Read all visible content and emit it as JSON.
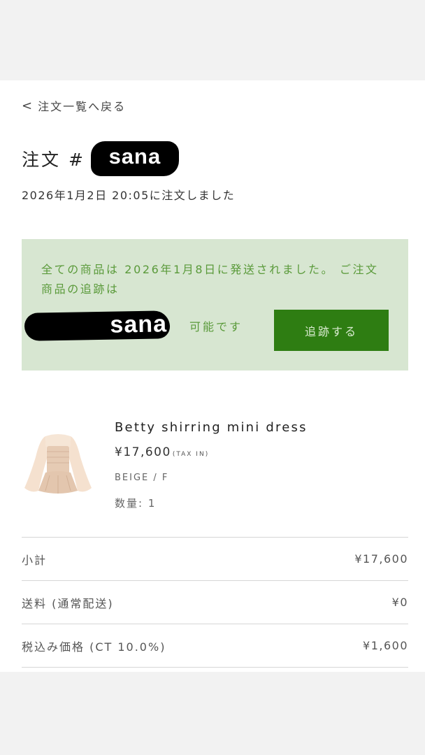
{
  "nav": {
    "back_label": "注文一覧へ戻る",
    "back_icon": "chevron-left-icon"
  },
  "order": {
    "title_prefix": "注文 #",
    "number_redacted": "sana",
    "date_text": "2026年1月2日 20:05に注文しました"
  },
  "notice": {
    "line1": "全ての商品は 2026年1月8日に発送されました。 ご注文商品の追跡は",
    "tracking_redacted": "sana",
    "available_text": "可能です",
    "track_button_label": "追跡する",
    "colors": {
      "background": "#d7e6d1",
      "text": "#5a9a3a",
      "button": "#2e7d12"
    }
  },
  "product": {
    "name": "Betty shirring mini dress",
    "price": "¥17,600",
    "tax_note": "(TAX IN)",
    "variant": "BEIGE / F",
    "quantity_text": "数量: 1"
  },
  "summary": [
    {
      "label": "小計",
      "value": "¥17,600"
    },
    {
      "label": "送料 (通常配送)",
      "value": "¥0"
    },
    {
      "label": "税込み価格 (CT 10.0%)",
      "value": "¥1,600"
    }
  ]
}
